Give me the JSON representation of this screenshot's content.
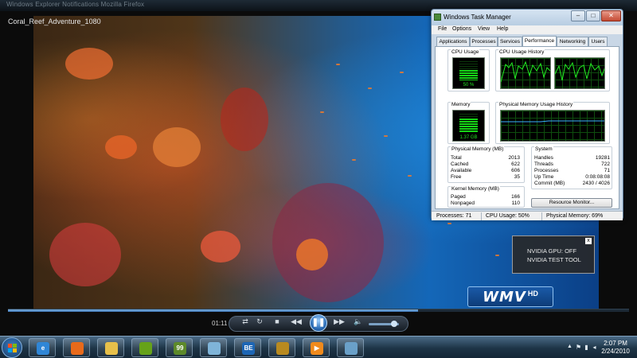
{
  "player": {
    "background_tabs_text": "Windows Explorer   Notifications   Mozilla Firefox",
    "title": "Coral_Reef_Adventure_1080",
    "time": "01:11",
    "progress_fraction": 0.66,
    "volume_fraction": 0.85,
    "wmv_logo": {
      "text": "WMV",
      "badge": "HD"
    },
    "controls": {
      "shuffle": "⇄",
      "repeat": "↻",
      "stop": "■",
      "previous": "◀◀",
      "play_pause": "❚❚",
      "next": "▶▶",
      "volume": "🔈"
    }
  },
  "task_manager": {
    "title": "Windows Task Manager",
    "window_buttons": {
      "minimize": "–",
      "maximize": "□",
      "close": "✕"
    },
    "menu": [
      "File",
      "Options",
      "View",
      "Help"
    ],
    "tabs": [
      "Applications",
      "Processes",
      "Services",
      "Performance",
      "Networking",
      "Users"
    ],
    "active_tab": "Performance",
    "cpu_usage": {
      "label": "CPU Usage",
      "value": "50 %",
      "fraction": 0.5
    },
    "cpu_history": {
      "label": "CPU Usage History"
    },
    "memory": {
      "label": "Memory",
      "value": "1.37 GB",
      "fraction": 0.69
    },
    "memory_history": {
      "label": "Physical Memory Usage History"
    },
    "physical_memory": {
      "label": "Physical Memory (MB)",
      "rows": [
        {
          "name": "Total",
          "value": "2013"
        },
        {
          "name": "Cached",
          "value": "622"
        },
        {
          "name": "Available",
          "value": "606"
        },
        {
          "name": "Free",
          "value": "35"
        }
      ]
    },
    "kernel_memory": {
      "label": "Kernel Memory (MB)",
      "rows": [
        {
          "name": "Paged",
          "value": "166"
        },
        {
          "name": "Nonpaged",
          "value": "110"
        }
      ]
    },
    "system": {
      "label": "System",
      "rows": [
        {
          "name": "Handles",
          "value": "19281"
        },
        {
          "name": "Threads",
          "value": "722"
        },
        {
          "name": "Processes",
          "value": "71"
        },
        {
          "name": "Up Time",
          "value": "0:08:08:08"
        },
        {
          "name": "Commit (MB)",
          "value": "2430 / 4026"
        }
      ]
    },
    "resource_monitor_button": "Resource Monitor...",
    "status": {
      "processes": "Processes: 71",
      "cpu": "CPU Usage: 50%",
      "memory": "Physical Memory: 69%"
    }
  },
  "nvidia_overlay": {
    "line1": "NVIDIA GPU: OFF",
    "line2": "NVIDIA TEST TOOL",
    "close": "x"
  },
  "taskbar": {
    "apps": [
      {
        "name": "Internet Explorer",
        "icon": "ie-icon",
        "glyph": "e",
        "color": "#2f86d6"
      },
      {
        "name": "Firefox",
        "icon": "firefox-icon",
        "glyph": "",
        "color": "#e86a1b"
      },
      {
        "name": "Windows Explorer",
        "icon": "folder-icon",
        "glyph": "",
        "color": "#e7c04a"
      },
      {
        "name": "NVIDIA",
        "icon": "nvidia-icon",
        "glyph": "",
        "color": "#66a21a"
      },
      {
        "name": "GPU-Z",
        "icon": "gpu-z-icon",
        "glyph": "99",
        "color": "#5d8a2a"
      },
      {
        "name": "Snipping Tool",
        "icon": "snipping-tool-icon",
        "glyph": "",
        "color": "#7fb4d8"
      },
      {
        "name": "BE",
        "icon": "be-icon",
        "glyph": "BE",
        "color": "#1d66b5"
      },
      {
        "name": "Webcam",
        "icon": "webcam-icon",
        "glyph": "",
        "color": "#b88a20"
      },
      {
        "name": "Windows Media Player",
        "icon": "media-player-icon",
        "glyph": "▶",
        "color": "#f08a1c"
      },
      {
        "name": "Network",
        "icon": "network-icon",
        "glyph": "",
        "color": "#6aa0c8"
      }
    ],
    "tray": {
      "arrow": "▲",
      "flag": "⚑",
      "network": "▮",
      "volume": "◂"
    },
    "time": "2:07 PM",
    "date": "2/24/2010"
  }
}
